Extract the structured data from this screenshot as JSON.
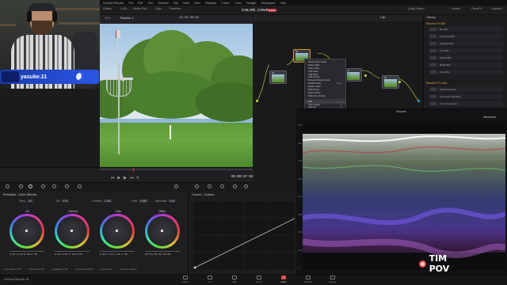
{
  "menubar": [
    "DaVinci Resolve",
    "File",
    "Edit",
    "Trim",
    "Timeline",
    "Clip",
    "Mark",
    "View",
    "Playback",
    "Fusion",
    "Color",
    "Fairlight",
    "Workspace",
    "Help"
  ],
  "toolbar": {
    "project_title": "COLOR_COURSE",
    "edited_tag": "Edited",
    "left_items": [
      "Gallery",
      "LUTs",
      "Media Pool",
      "Clips",
      "Timelines"
    ],
    "right_items": [
      "Nodes",
      "OpenFX",
      "Lightbox"
    ],
    "quick_export": "Quick Export"
  },
  "webcam": {
    "name": "yasuke.11"
  },
  "viewer": {
    "zoom": "37%",
    "timeline_name": "Timeline 1",
    "header_timecode": "13:52:36:04",
    "timecode": "00:00:07:04"
  },
  "nodes": {
    "clip_label": "Clip",
    "items": [
      {
        "num": "01"
      },
      {
        "num": "02"
      },
      {
        "num": "03"
      },
      {
        "num": "04"
      },
      {
        "num": "05"
      }
    ]
  },
  "context_menu": {
    "items": [
      {
        "label": "Reset Node Grade",
        "shortcut": ""
      },
      {
        "label": "Node Label",
        "shortcut": ""
      },
      {
        "label": "Node Color",
        "shortcut": ""
      },
      {
        "label": "Add Node",
        "shortcut": ""
      },
      {
        "label": "Add Mixer",
        "shortcut": ""
      },
      {
        "label": "Add Source",
        "shortcut": ""
      },
      {
        "label": "Save as Shared Node",
        "shortcut": ""
      },
      {
        "label": "Enable Node",
        "shortcut": "Ctrl+D"
      },
      {
        "label": "Delete Node",
        "shortcut": ""
      },
      {
        "label": "HDR Mode",
        "shortcut": ""
      },
      {
        "label": "Node Cache",
        "shortcut": ""
      },
      {
        "label": "Node Key Output",
        "shortcut": ""
      },
      {
        "label": "LUT",
        "shortcut": "▸"
      },
      {
        "label": "Color Space",
        "shortcut": "▸"
      },
      {
        "label": "Gamma",
        "shortcut": "▸"
      },
      {
        "label": "Channel",
        "shortcut": "▸"
      },
      {
        "label": "Set Mode",
        "shortcut": "▸"
      },
      {
        "label": "Render Cache",
        "shortcut": "▸"
      },
      {
        "label": "Composite Mode",
        "shortcut": "▸"
      }
    ]
  },
  "library": {
    "title": "Library",
    "section1": "Resolve FX Blur",
    "section1_items": [
      "Box Blur",
      "Directional Blur",
      "Gaussian Blur",
      "Lens Blur",
      "Mosaic Blur",
      "Radial Blur",
      "Zoom Blur"
    ],
    "section2": "Resolve FX Color",
    "section2_items": [
      "ACES Transform",
      "Chromatic Adaptation",
      "Color Compressor"
    ]
  },
  "scopes": {
    "title": "Scopes",
    "type": "Waveform",
    "scale": [
      "1023",
      "896",
      "768",
      "640",
      "512",
      "384",
      "256",
      "128",
      "0"
    ]
  },
  "color_panel": {
    "primaries_title": "Primaries - Color Wheels",
    "params": [
      {
        "label": "Temp",
        "value": "0.0"
      },
      {
        "label": "Tint",
        "value": "0.00"
      },
      {
        "label": "Contrast",
        "value": "1.000"
      },
      {
        "label": "Pivot",
        "value": "0.435"
      },
      {
        "label": "Mid/Detail",
        "value": "0.00"
      }
    ],
    "wheels": [
      {
        "label": "Lift",
        "values": "0.00  0.00  0.00  0.00"
      },
      {
        "label": "Gamma",
        "values": "0.00  0.00  0.00  0.00"
      },
      {
        "label": "Gain",
        "values": "1.00  1.00  1.00  1.00"
      },
      {
        "label": "Offset",
        "values": "25.00  25.00  25.00"
      }
    ],
    "bottom_params": [
      "Color Boost 0.00",
      "Shadows 0.00",
      "Highlights 0.00",
      "Saturation 50.00",
      "Hue 50.00",
      "Lum Mix 100.00"
    ]
  },
  "curves": {
    "title": "Curves - Custom"
  },
  "overlay": {
    "tag": "TIM POV"
  },
  "pages": [
    {
      "label": "Media",
      "active": false
    },
    {
      "label": "Cut",
      "active": false
    },
    {
      "label": "Edit",
      "active": false
    },
    {
      "label": "Fusion",
      "active": false
    },
    {
      "label": "Color",
      "active": true
    },
    {
      "label": "Fairlight",
      "active": false
    },
    {
      "label": "Deliver",
      "active": false
    }
  ],
  "app_name": "DaVinci Resolve 18"
}
